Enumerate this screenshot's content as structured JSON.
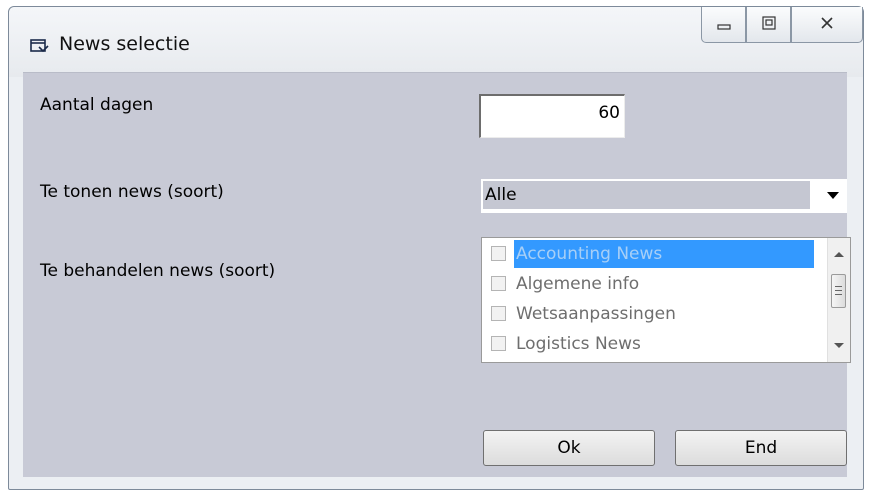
{
  "window": {
    "title": "News selectie"
  },
  "form": {
    "days_label": "Aantal dagen",
    "days_value": "60",
    "show_label": "Te tonen news (soort)",
    "show_selected": "Alle",
    "handle_label": "Te behandelen news (soort)",
    "handle_items": [
      {
        "label": "Accounting News",
        "checked": false,
        "selected": true
      },
      {
        "label": "Algemene info",
        "checked": false,
        "selected": false
      },
      {
        "label": "Wetsaanpassingen",
        "checked": false,
        "selected": false
      },
      {
        "label": "Logistics News",
        "checked": false,
        "selected": false
      }
    ]
  },
  "buttons": {
    "ok_label": "Ok",
    "end_label": "End"
  },
  "icons": {
    "title_icon": "window-app-icon",
    "minimize": "minimize-icon",
    "maximize": "maximize-icon",
    "close": "close-icon"
  },
  "colors": {
    "client_background": "#c8cad6",
    "selection": "#3399ff"
  }
}
